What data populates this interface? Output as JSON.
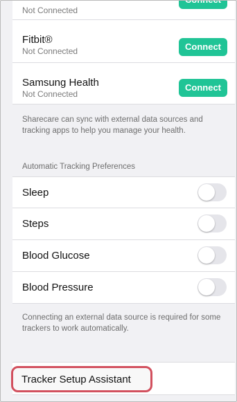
{
  "sources": [
    {
      "name": "",
      "status": "Not Connected",
      "button": "Connect"
    },
    {
      "name": "Fitbit®",
      "status": "Not Connected",
      "button": "Connect"
    },
    {
      "name": "Samsung Health",
      "status": "Not Connected",
      "button": "Connect"
    }
  ],
  "sync_note": "Sharecare can sync with external data sources and tracking apps to help you manage your health.",
  "tracking_header": "Automatic Tracking Preferences",
  "tracking_items": [
    {
      "label": "Sleep",
      "enabled": false
    },
    {
      "label": "Steps",
      "enabled": false
    },
    {
      "label": "Blood Glucose",
      "enabled": false
    },
    {
      "label": "Blood Pressure",
      "enabled": false
    }
  ],
  "tracking_note": "Connecting an external data source is required for some trackers to work automatically.",
  "setup_assistant_label": "Tracker Setup Assistant",
  "colors": {
    "connect_button": "#20c496",
    "highlight": "#d2505e"
  }
}
